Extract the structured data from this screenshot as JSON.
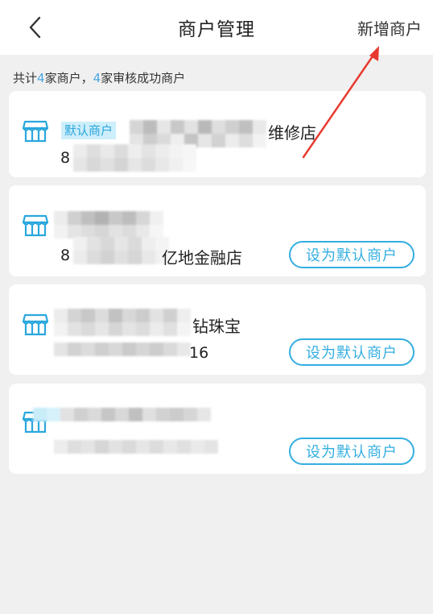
{
  "header": {
    "title": "商户管理",
    "add_label": "新增商户"
  },
  "summary": {
    "prefix": "共计",
    "total": "4",
    "middle": "家商户，",
    "approved": "4",
    "suffix": "家审核成功商户"
  },
  "merchants": [
    {
      "default_tag": "默认商户",
      "name_visible": "维修店",
      "code_visible": "8"
    },
    {
      "name_visible": "亿地金融店",
      "code_visible": "8",
      "button": "设为默认商户"
    },
    {
      "name_visible": "钻珠宝",
      "code_visible": "16",
      "button": "设为默认商户"
    },
    {
      "button": "设为默认商户"
    }
  ],
  "colors": {
    "accent": "#33aee0",
    "highlight": "#4da6e0",
    "annotation_arrow": "#e8392f"
  },
  "icons": {
    "back": "chevron-left-icon",
    "shop": "storefront-icon"
  }
}
